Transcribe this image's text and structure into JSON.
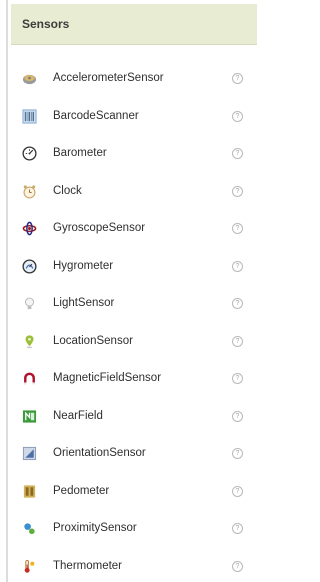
{
  "panel": {
    "title": "Sensors"
  },
  "help_glyph": "?",
  "items": [
    {
      "label": "AccelerometerSensor",
      "icon": "accelerometer-icon"
    },
    {
      "label": "BarcodeScanner",
      "icon": "barcode-scanner-icon"
    },
    {
      "label": "Barometer",
      "icon": "barometer-icon"
    },
    {
      "label": "Clock",
      "icon": "clock-icon"
    },
    {
      "label": "GyroscopeSensor",
      "icon": "gyroscope-icon"
    },
    {
      "label": "Hygrometer",
      "icon": "hygrometer-icon"
    },
    {
      "label": "LightSensor",
      "icon": "light-bulb-icon"
    },
    {
      "label": "LocationSensor",
      "icon": "location-pin-icon"
    },
    {
      "label": "MagneticFieldSensor",
      "icon": "magnet-icon"
    },
    {
      "label": "NearField",
      "icon": "nfc-icon"
    },
    {
      "label": "OrientationSensor",
      "icon": "orientation-icon"
    },
    {
      "label": "Pedometer",
      "icon": "pedometer-icon"
    },
    {
      "label": "ProximitySensor",
      "icon": "proximity-icon"
    },
    {
      "label": "Thermometer",
      "icon": "thermometer-icon"
    }
  ]
}
